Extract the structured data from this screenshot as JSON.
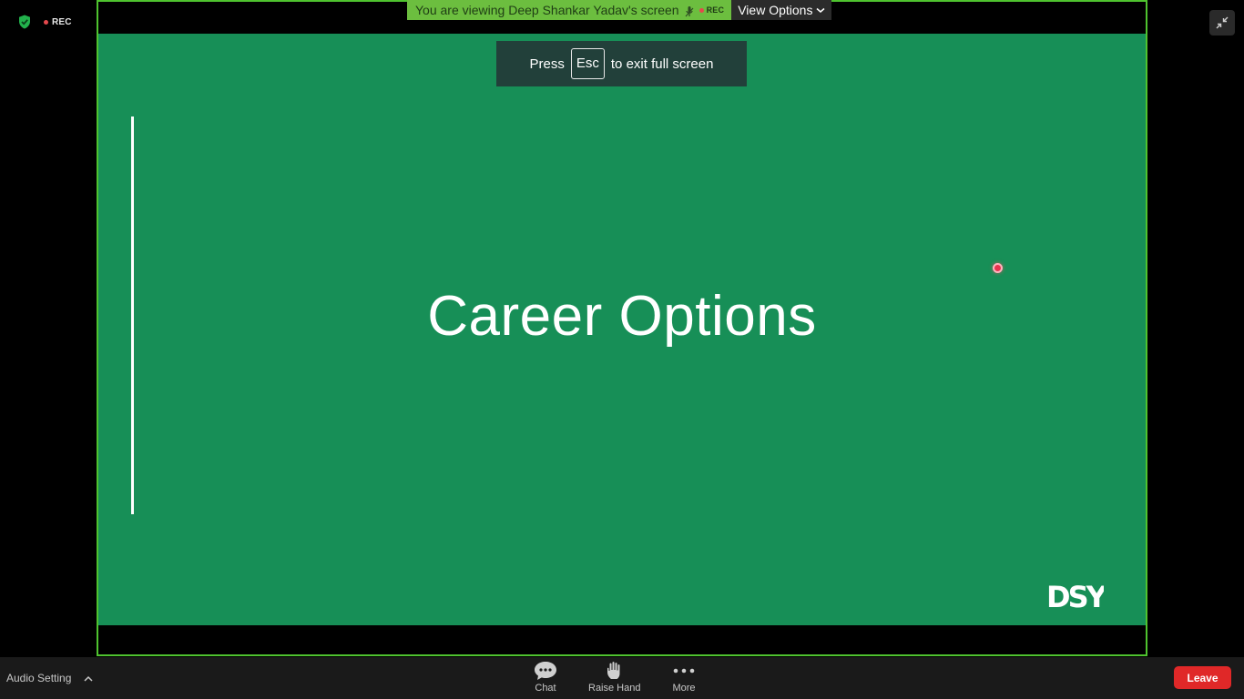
{
  "status": {
    "rec_label": "REC"
  },
  "share_banner": {
    "text": "You are viewing Deep Shankar Yadav's screen",
    "rec_label": "REC",
    "view_options_label": "View Options"
  },
  "esc_toast": {
    "press": "Press",
    "key": "Esc",
    "rest": "to exit full screen"
  },
  "slide": {
    "title": "Career Options",
    "logo_text": "DSY"
  },
  "toolbar": {
    "audio_setting_label": "Audio Setting",
    "chat_label": "Chat",
    "raise_hand_label": "Raise Hand",
    "more_label": "More",
    "leave_label": "Leave"
  },
  "colors": {
    "slide_bg": "#178f57",
    "share_border": "#4fc32f",
    "banner_bg": "#6cbe3f",
    "leave_bg": "#e02828",
    "rec_dot": "#e5484d"
  },
  "icons": [
    "shield-check-icon",
    "exit-fullscreen-icon",
    "chat-icon",
    "raise-hand-icon",
    "more-icon",
    "chevron-up-icon",
    "chevron-down-icon",
    "mic-icon"
  ]
}
